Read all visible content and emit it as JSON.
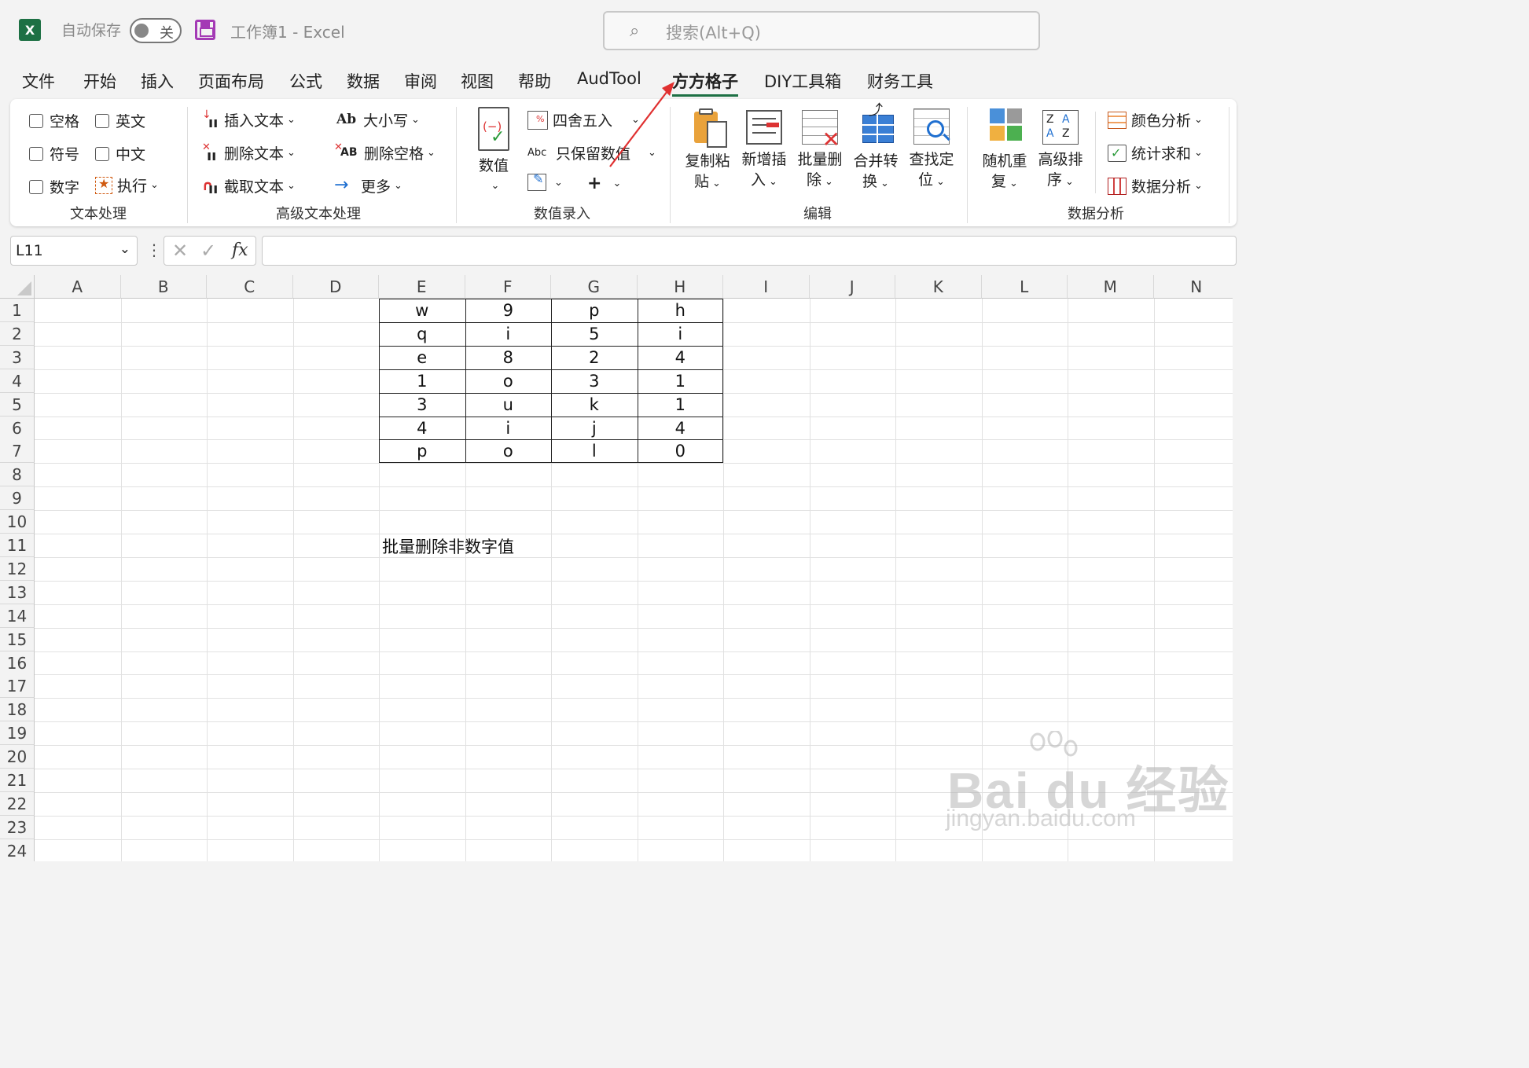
{
  "titlebar": {
    "app_icon": "X",
    "autosave_label": "自动保存",
    "autosave_state": "关",
    "workbook_title": "工作簿1  -  Excel",
    "search_placeholder": "搜索(Alt+Q)"
  },
  "menu": [
    "文件",
    "开始",
    "插入",
    "页面布局",
    "公式",
    "数据",
    "审阅",
    "视图",
    "帮助",
    "AudTool",
    "方方格子",
    "DIY工具箱",
    "财务工具"
  ],
  "active_menu": "方方格子",
  "ribbon": {
    "text_group": {
      "label": "文本处理",
      "items": [
        "空格",
        "英文",
        "符号",
        "中文",
        "数字",
        "执行"
      ]
    },
    "adv_group": {
      "label": "高级文本处理",
      "items": [
        "插入文本",
        "删除文本",
        "截取文本",
        "大小写",
        "删除空格",
        "更多"
      ]
    },
    "num_group": {
      "label": "数值录入",
      "big": "数值",
      "items": [
        "四舍五入",
        "只保留数值"
      ]
    },
    "edit_group": {
      "label": "编辑",
      "buttons": [
        [
          "复制粘",
          "贴"
        ],
        [
          "新增插",
          "入"
        ],
        [
          "批量删",
          "除"
        ],
        [
          "合并转",
          "换"
        ],
        [
          "查找定",
          "位"
        ]
      ]
    },
    "analysis_group": {
      "label": "数据分析",
      "buttons": [
        [
          "随机重",
          "复"
        ],
        [
          "高级排",
          "序"
        ]
      ],
      "items": [
        "颜色分析",
        "统计求和",
        "数据分析"
      ]
    }
  },
  "formula_bar": {
    "name_box": "L11",
    "fx": "fx",
    "value": ""
  },
  "columns": [
    "A",
    "B",
    "C",
    "D",
    "E",
    "F",
    "G",
    "H",
    "I",
    "J",
    "K",
    "L",
    "M",
    "N"
  ],
  "rows": [
    "1",
    "2",
    "3",
    "4",
    "5",
    "6",
    "7",
    "8",
    "9",
    "10",
    "11",
    "12",
    "13",
    "14",
    "15",
    "16",
    "17",
    "18",
    "19",
    "20",
    "21",
    "22",
    "23",
    "24"
  ],
  "table": [
    [
      "w",
      "9",
      "p",
      "h"
    ],
    [
      "q",
      "i",
      "5",
      "i"
    ],
    [
      "e",
      "8",
      "2",
      "4"
    ],
    [
      "1",
      "o",
      "3",
      "1"
    ],
    [
      "3",
      "u",
      "k",
      "1"
    ],
    [
      "4",
      "i",
      "j",
      "4"
    ],
    [
      "p",
      "o",
      "l",
      "0"
    ]
  ],
  "note": "批量删除非数字值",
  "watermark": {
    "brand": "Bai  du 经验",
    "url": "jingyan.baidu.com"
  },
  "colors": {
    "excel_green": "#1d7044",
    "arrow_red": "#e03030",
    "save_purple": "#a43ab5"
  }
}
